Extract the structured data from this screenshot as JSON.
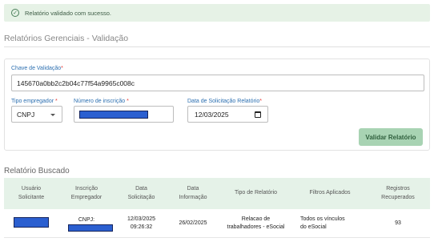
{
  "alert": {
    "message": "Relatório validado com sucesso."
  },
  "page": {
    "title": "Relatórios Gerenciais - Validação"
  },
  "form": {
    "chave": {
      "label": "Chave de Validação",
      "required_mark": "*",
      "value": "145670a0bb2c2b04c77f54a9965c008c"
    },
    "tipo": {
      "label": "Tipo empregador",
      "required_mark": "*",
      "value": "CNPJ"
    },
    "numero": {
      "label": "Número de inscrição",
      "required_mark": "*"
    },
    "data": {
      "label": "Data de Solicitação Relatório",
      "required_mark": "*",
      "value": "12/03/2025"
    },
    "submit_label": "Validar Relatório"
  },
  "results": {
    "title": "Relatório Buscado",
    "columns": [
      [
        "Usuário",
        "Solicitante"
      ],
      [
        "Inscrição",
        "Empregador"
      ],
      [
        "Data",
        "Solicitação"
      ],
      [
        "Data",
        "Informação"
      ],
      [
        "Tipo de Relatório"
      ],
      [
        "Filtros Aplicados"
      ],
      [
        "Registros",
        "Recuperados"
      ]
    ],
    "row": {
      "inscricao_prefix": "CNPJ:",
      "data_solicitacao_date": "12/03/2025",
      "data_solicitacao_time": "09:26:32",
      "data_informacao": "26/02/2025",
      "tipo_l1": "Relacao de",
      "tipo_l2": "trabalhadores - eSocial",
      "filtros_l1": "Todos os vínculos",
      "filtros_l2": "do eSocial",
      "registros": "93"
    }
  },
  "colors": {
    "accent_green": "#a8d3b3",
    "label_blue": "#2c6fb0",
    "header_bg": "#e5f2e8"
  }
}
